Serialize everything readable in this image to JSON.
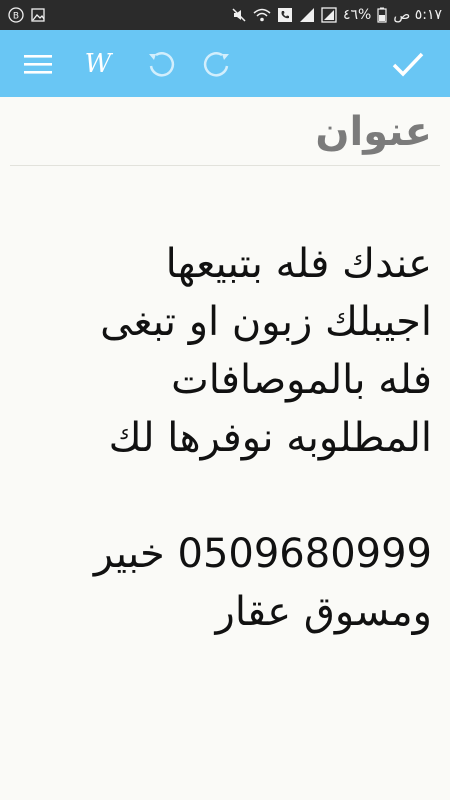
{
  "status_bar": {
    "time": "٥:١٧ ص",
    "battery": "٤٦%"
  },
  "toolbar": {
    "icons": [
      "menu-icon",
      "formatting-icon",
      "undo-icon",
      "redo-icon",
      "check-icon"
    ],
    "format_label": "W"
  },
  "note": {
    "title": "عنوان",
    "body": "عندك فله بتبيعها\nاجيبلك زبون او تبغى\nفله بالموصافات\nالمطلوبه نوفرها لك\n\n0509680999 خبير\nومسوق عقار"
  },
  "colors": {
    "toolbar": "#69c6f4",
    "status_bar": "#2b2b2b",
    "background": "#fafaf7",
    "title_text": "#7b7b7b",
    "body_text": "#111111"
  }
}
